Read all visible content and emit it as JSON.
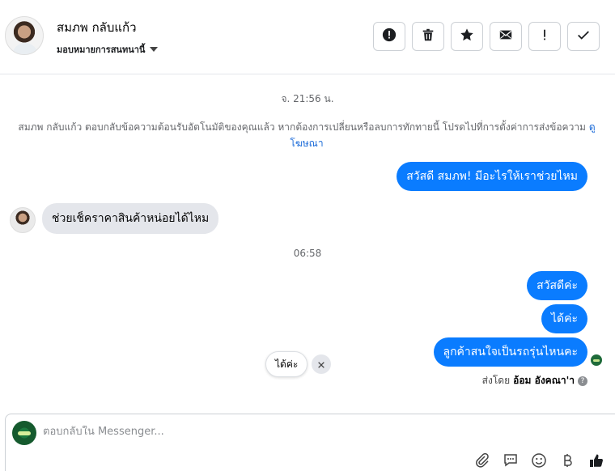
{
  "header": {
    "contact_name": "สมภพ กลับแก้ว",
    "assign_label": "มอบหมายการสนทนานี้",
    "actions": [
      {
        "name": "report-icon"
      },
      {
        "name": "trash-icon"
      },
      {
        "name": "star-icon"
      },
      {
        "name": "envelope-icon"
      },
      {
        "name": "important-icon"
      },
      {
        "name": "check-icon"
      }
    ]
  },
  "thread": {
    "timestamp_1": "จ. 21:56 น.",
    "system_message": "สมภพ กลับแก้ว ตอบกลับข้อความต้อนรับอัตโนมัติของคุณแล้ว หากต้องการเปลี่ยนหรือลบการทักทายนี้ โปรดไปที่การตั้งค่าการส่งข้อความ",
    "system_link": "ดูโฆษณา",
    "outgoing_1": "สวัสดี สมภพ! มีอะไรให้เราช่วยไหม",
    "incoming_1": "ช่วยเช็คราคาสินค้าหน่อยได้ไหม",
    "timestamp_2": "06:58",
    "outgoing_2": "สวัสดีค่ะ",
    "outgoing_3": "ได้ค่ะ",
    "outgoing_4": "ลูกค้าสนใจเป็นรถรุ่นไหนคะ",
    "sent_by_prefix": "ส่งโดย",
    "sent_by_name": "อ้อม อังคณา'า",
    "quick_reply": "ได้ค่ะ"
  },
  "composer": {
    "placeholder": "ตอบกลับใน Messenger...",
    "icons": [
      "paperclip-icon",
      "saved-reply-icon",
      "emoji-icon",
      "baht-icon",
      "like-icon"
    ]
  },
  "colors": {
    "accent": "#0a7cff",
    "incoming_bubble": "#e4e6eb",
    "link": "#1a6ad8"
  }
}
